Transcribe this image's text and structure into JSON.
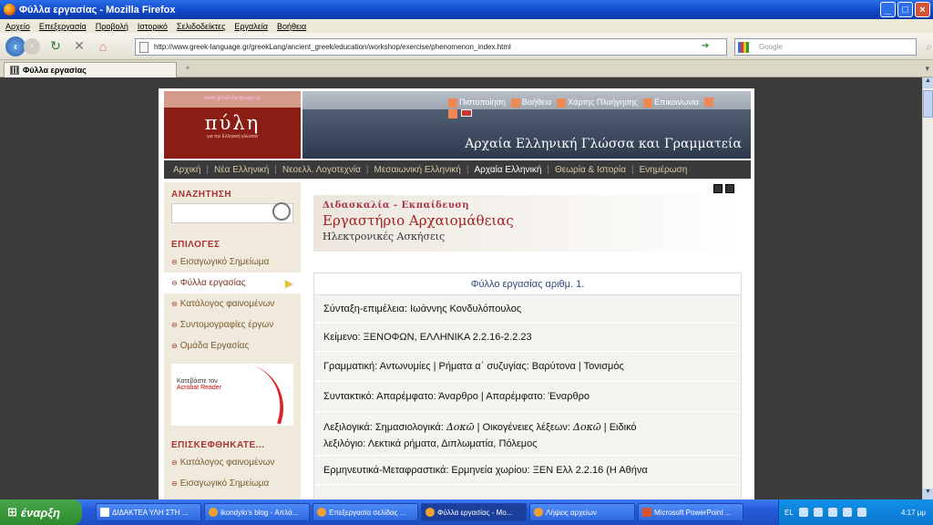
{
  "window": {
    "title": "Φύλλα εργασίας - Mozilla Firefox"
  },
  "menu": [
    "Αρχείο",
    "Επεξεργασία",
    "Προβολή",
    "Ιστορικό",
    "Σελιδοδείκτες",
    "Εργαλεία",
    "Βοήθεια"
  ],
  "nav": {
    "url": "http://www.greek-language.gr/greekLang/ancient_greek/education/workshop/exercise/phenomenon_index.html",
    "search_placeholder": "Google"
  },
  "tab": {
    "label": "Φύλλα εργασίας",
    "new_tab": "+"
  },
  "site": {
    "logo_site": "www.greek-language.gr",
    "logo_title": "πύλη",
    "logo_sub": "για την Ελληνική γλώσσα",
    "util": [
      "Πιστοποίηση",
      "Βοήθεια",
      "Χάρτης Πλοήγησης",
      "Επικοινωνία"
    ],
    "banner_title": "Αρχαία Ελληνική Γλώσσα και Γραμματεία",
    "mainnav": [
      "Αρχική",
      "Νέα Ελληνική",
      "Νεοελλ. Λογοτεχνία",
      "Μεσαιωνική Ελληνική",
      "Αρχαία Ελληνική",
      "Θεωρία & Ιστορία",
      "Ενημέρωση"
    ]
  },
  "sidebar": {
    "search_heading": "ΑΝΑΖΗΤΗΣΗ",
    "options_heading": "ΕΠΙΛΟΓΕΣ",
    "items": [
      "Εισαγωγικό Σημείωμα",
      "Φύλλα εργασίας",
      "Κατάλογος φαινομένων",
      "Συντομογραφίες έργων",
      "Ομάδα Εργασίας"
    ],
    "acrobat_line1": "Κατεβάστε τον",
    "acrobat_line2": "Acrobat Reader",
    "visited_heading": "ΕΠΙΣΚΕΦΘΗΚΑΤΕ...",
    "visited_items": [
      "Κατάλογος φαινομένων",
      "Εισαγωγικό Σημείωμα"
    ]
  },
  "content": {
    "kicker": "Διδασκαλία - Εκπαίδευση",
    "title": "Εργαστήριο Αρχαιομάθειας",
    "subtitle": "Ηλεκτρονικές Ασκήσεις",
    "sheet_title": "Φύλλο εργασίας αριθμ. 1.",
    "rows": [
      "Σύνταξη-επιμέλεια: Ιωάννης Κονδυλόπουλος",
      "Κείμενο: ΞΕΝΟΦΩΝ, ΕΛΛΗΝΙΚΑ 2.2.16-2.2.23",
      "Γραμματική: Αντωνυμίες | Ρήματα α΄ συζυγίας: Βαρύτονα | Τονισμός",
      "Συντακτικό: Απαρέμφατο: Άναρθρο | Απαρέμφατο: Έναρθρο",
      "Ερμηνευτικά-Μεταφραστικά: Ερμηνεία χωρίου: ΞΕΝ Ελλ 2.2.16 (Η Αθήνα"
    ],
    "lex_prefix": "Λεξιλογικά: Σημασιολογικά: ",
    "lex_word1": "Δοκῶ",
    "lex_mid": " | Οικογένειες λέξεων: ",
    "lex_word2": "Δοκῶ",
    "lex_suffix": " | Ειδικό",
    "lex_line2": "λεξιλόγιο: Λεκτικά ρήματα, Διπλωματία, Πόλεμος"
  },
  "taskbar": {
    "start": "έναρξη",
    "tasks": [
      "ΔΙΔΑΚΤΕΑ ΥΛΗ ΣΤΗ ...",
      "ikondylo's blog - Απλά...",
      "Επεξεργασία σελίδας ...",
      "Φύλλα εργασίας - Mo...",
      "Λήψεις αρχείων",
      "Microsoft PowerPoint ..."
    ],
    "lang": "EL",
    "clock": "4:17 μμ"
  }
}
